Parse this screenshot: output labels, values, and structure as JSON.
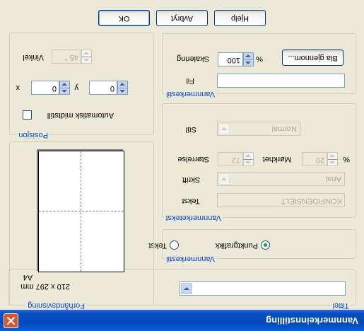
{
  "window": {
    "title": "Vannmerkeinnstilling"
  },
  "title_section": {
    "legend": "Tittel",
    "selected": ""
  },
  "style_section": {
    "legend": "Vannmerkestil",
    "options": [
      "Tekst",
      "Punktgrafikk"
    ],
    "selected": "Punktgrafikk"
  },
  "text_section": {
    "legend": "Vannmerketekst",
    "text_label": "Tekst",
    "text_value": "KONFIDENSIELT",
    "font_label": "Skrift",
    "font_value": "Arial",
    "size_label": "Størrelse",
    "size_value": "72",
    "darkness_label": "Mørkhet",
    "darkness_value": "20",
    "darkness_unit": "%",
    "style_label": "Stil",
    "style_value": "Normal"
  },
  "bitmap_section": {
    "legend": "Vannmerkestil",
    "file_label": "Fil",
    "file_value": "",
    "scale_label": "Skalering",
    "scale_value": "100",
    "scale_unit": "%",
    "browse_label": "Bla gjennom..."
  },
  "preview_section": {
    "legend": "Forhåndsvisning",
    "paper_name": "A4",
    "paper_size": "210 x 297 mm"
  },
  "position_section": {
    "legend": "Posisjon",
    "auto_center_label": "Automatisk midtstill",
    "auto_center_checked": false,
    "x_label": "x",
    "x_value": "0",
    "y_label": "y",
    "y_value": "0",
    "angle_label": "Vinkel",
    "angle_value": "45 °"
  },
  "buttons": {
    "ok": "OK",
    "cancel": "Avbryt",
    "help": "Hjelp"
  }
}
